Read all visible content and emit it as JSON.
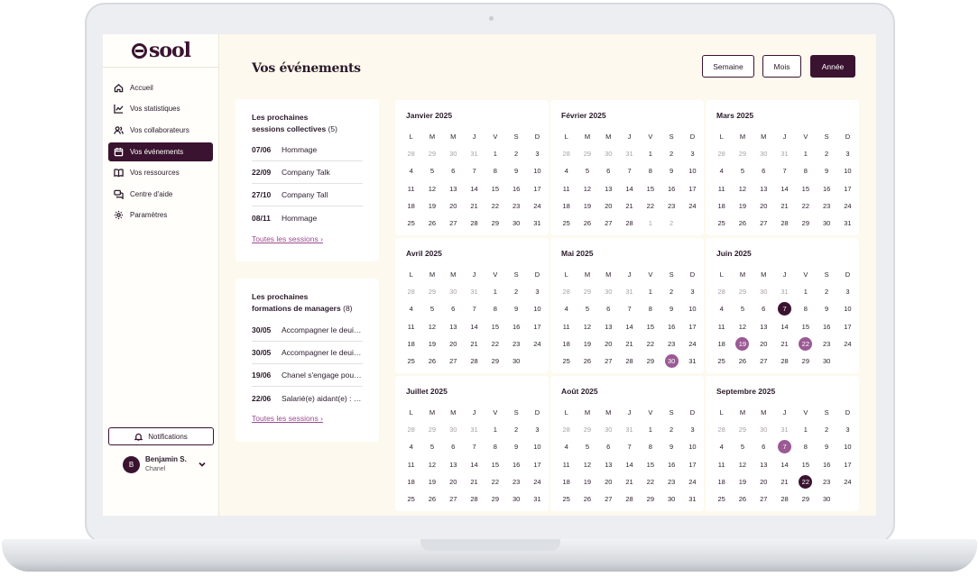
{
  "app": {
    "logo": "sool"
  },
  "sidebar": {
    "items": [
      {
        "label": "Accueil",
        "icon": "home-icon",
        "active": false
      },
      {
        "label": "Vos statistiques",
        "icon": "chart-icon",
        "active": false
      },
      {
        "label": "Vos collaborateurs",
        "icon": "users-icon",
        "active": false
      },
      {
        "label": "Vos événements",
        "icon": "calendar-icon",
        "active": true
      },
      {
        "label": "Vos ressources",
        "icon": "book-icon",
        "active": false
      },
      {
        "label": "Centre d'aide",
        "icon": "chat-icon",
        "active": false
      },
      {
        "label": "Paramètres",
        "icon": "gear-icon",
        "active": false
      }
    ],
    "notifications_label": "Notifications",
    "user": {
      "initial": "B",
      "name": "Benjamin S.",
      "company": "Chanel"
    }
  },
  "header": {
    "title": "Vos événements",
    "view_buttons": [
      {
        "label": "Semaine",
        "active": false
      },
      {
        "label": "Mois",
        "active": false
      },
      {
        "label": "Année",
        "active": true
      }
    ]
  },
  "upcoming_sessions": {
    "title_line1": "Les prochaines",
    "title_line2": "sessions collectives",
    "count": "(5)",
    "items": [
      {
        "date": "07/06",
        "name": "Hommage"
      },
      {
        "date": "22/09",
        "name": "Company Talk"
      },
      {
        "date": "27/10",
        "name": "Company Tall"
      },
      {
        "date": "08/11",
        "name": "Hommage"
      }
    ],
    "link": "Toutes les sessions ›"
  },
  "upcoming_trainings": {
    "title_line1": "Les prochaines",
    "title_line2": "formations de managers",
    "count": "(8)",
    "items": [
      {
        "date": "30/05",
        "name": "Accompagner le deuil au travail"
      },
      {
        "date": "30/05",
        "name": "Accompagner le deuil au travail"
      },
      {
        "date": "19/06",
        "name": "Chanel s'engage pour l'aidance"
      },
      {
        "date": "22/06",
        "name": "Salarié(e) aidant(e) : comment l'accompagner"
      }
    ],
    "link": "Toutes les sessions ›"
  },
  "calendar": {
    "weekdays": [
      "L",
      "M",
      "M",
      "J",
      "V",
      "S",
      "D"
    ],
    "colors": {
      "collective": "#3a1330",
      "training": "#9b5a94"
    },
    "months": [
      {
        "title": "Janvier 2025",
        "lead": [
          28,
          29,
          30,
          31
        ],
        "days": 31,
        "trail": [],
        "marks": {}
      },
      {
        "title": "Février 2025",
        "lead": [
          28,
          29,
          30,
          31
        ],
        "days": 28,
        "trail": [
          1,
          2
        ],
        "marks": {}
      },
      {
        "title": "Mars 2025",
        "lead": [
          28,
          29,
          30,
          31
        ],
        "days": 31,
        "trail": [],
        "marks": {}
      },
      {
        "title": "Avril 2025",
        "lead": [
          28,
          29,
          30,
          31
        ],
        "days": 30,
        "trail": [],
        "marks": {}
      },
      {
        "title": "Mai 2025",
        "lead": [
          28,
          29,
          30,
          31
        ],
        "days": 31,
        "trail": [],
        "marks": {
          "30": "form"
        }
      },
      {
        "title": "Juin 2025",
        "lead": [
          28,
          29,
          30,
          31
        ],
        "days": 30,
        "trail": [],
        "marks": {
          "7": "coll",
          "19": "form",
          "22": "form"
        }
      },
      {
        "title": "Juillet 2025",
        "lead": [
          28,
          29,
          30,
          31
        ],
        "days": 31,
        "trail": [],
        "marks": {}
      },
      {
        "title": "Août 2025",
        "lead": [
          28,
          29,
          30,
          31
        ],
        "days": 31,
        "trail": [],
        "marks": {}
      },
      {
        "title": "Septembre 2025",
        "lead": [
          28,
          29,
          30,
          31
        ],
        "days": 30,
        "trail": [],
        "marks": {
          "7": "form",
          "22": "coll"
        }
      }
    ]
  }
}
